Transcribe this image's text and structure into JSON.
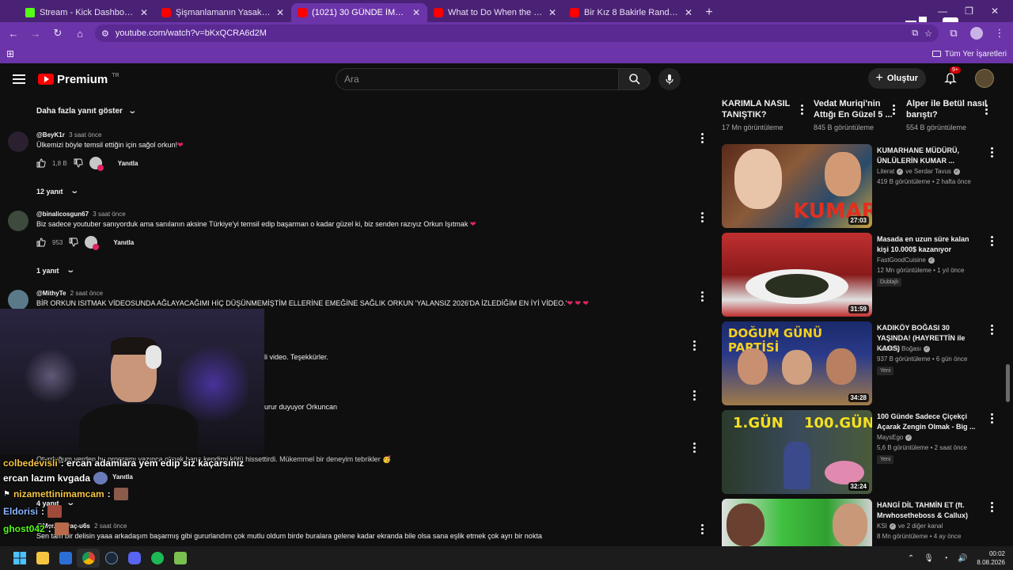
{
  "browser": {
    "tabs": [
      {
        "title": "Stream - Kick Dashboard",
        "favicon": "kick"
      },
      {
        "title": "Şişmanlamanın Yasak Olduğu Ü",
        "favicon": "youtube"
      },
      {
        "title": "(1021) 30 GÜNDE İMKANSIZI B",
        "favicon": "youtube",
        "active": true
      },
      {
        "title": "What to Do When the Gym Is B",
        "favicon": "youtube"
      },
      {
        "title": "Bir Kız 8 Bakirle Randevuda - Yo",
        "favicon": "youtube"
      }
    ],
    "url": "youtube.com/watch?v=bKxQCRA6d2M",
    "bookmarks_all": "Tüm Yer İşaretleri",
    "theme_color": "#6b34a8"
  },
  "yt_header": {
    "logo": "Premium",
    "region": "TR",
    "search_placeholder": "Ara",
    "create_label": "Oluştur",
    "notif_count": "9+"
  },
  "comments": {
    "more_replies": "Daha fazla yanıt göster",
    "reply_label": "Yanıtla",
    "items": [
      {
        "handle": "@BeyK1r",
        "time": "3 saat önce",
        "text": "Ülkemizi böyle temsil ettiğin için sağol orkun!",
        "likes": "1,8 B",
        "replies": "12 yanıt"
      },
      {
        "handle": "@binalicosgun67",
        "time": "3 saat önce",
        "text": "Biz sadece youtuber sanıyorduk ama sanılanın aksine Türkiye'yi temsil edip başarman o kadar güzel ki, biz senden razıyız Orkun Işıtmak",
        "likes": "953",
        "replies": "1 yanıt"
      },
      {
        "handle": "@MithyTe",
        "time": "2 saat önce",
        "text": "BİR ORKUN ISITMAK  VİDEOSUNDA  AĞLAYACAĞIMI HİÇ DÜŞÜNMEMİŞTİM ELLERİNE EMEĞİNE SAĞLIK ORKUN 'YALANSIZ 2026'DA  İZLEDİĞİM EN İYİ VİDEO.'"
      }
    ],
    "partial_1": "li video. Teşekkürler.",
    "partial_2": "urur duyuyor Orkuncan",
    "partial_3": "Oturduğum yerden bu programı yazınca olmak bana kendimi kötü hissettirdi. Mükemmel bir deneyim tebrikler",
    "partial_4_reply": "Yanıtla",
    "partial_4_replies": "4 yanıt",
    "last_handle": "@Mer... saraç-u6s",
    "last_time": "2 saat önce",
    "last_text": "Sen tam bir delisin yaaa arkadaşım başarmış gibi gururlandım çok mutlu oldum birde buralara gelene kadar ekranda bile olsa sana eşlik etmek çok ayrı bir nokta"
  },
  "chat": [
    {
      "user": "colbedevisli",
      "msg": ": ercan adamlara yem edip siz kaçarsınız",
      "color": "#f5c542"
    },
    {
      "user": "ercan lazım kvgada",
      "msg": "",
      "color": "#ffffff"
    },
    {
      "user": "nizamettinimamcam",
      "msg": ":",
      "color": "#f5c542"
    },
    {
      "user": "Eldorisi",
      "msg": ":",
      "color": "#8ab4ff"
    },
    {
      "user": "ghost042",
      "msg": ":",
      "color": "#53fc18"
    }
  ],
  "sidebar": {
    "top": [
      {
        "title": "KARIMLA NASIL TANIŞTIK?",
        "views": "17 Mn görüntüleme"
      },
      {
        "title": "Vedat Muriqi'nin Attığı En Güzel 5 ...",
        "views": "845 B görüntüleme"
      },
      {
        "title": "Alper ile Betül nasıl barıştı?",
        "views": "554 B görüntüleme"
      }
    ],
    "recs": [
      {
        "title": "KUMARHANE MÜDÜRÜ, ÜNLÜLERİN KUMAR ...",
        "channel": "Literat",
        "channel_extra": "ve Serdar Tavus",
        "meta": "419 B görüntüleme • 2 hafta önce",
        "duration": "27:03",
        "thumb_text": "KUMAR"
      },
      {
        "title": "Masada en uzun süre kalan kişi 10.000$ kazanıyor",
        "channel": "FastGoodCuisine",
        "channel_extra": "",
        "meta": "12 Mn görüntüleme • 1 yıl önce",
        "badge": "Dublajlı",
        "duration": "31:59"
      },
      {
        "title": "KADIKÖY BOĞASI 30 YAŞINDA! (HAYRETTİN ile KAOS)",
        "channel": "Kadıköy Boğası",
        "channel_extra": "",
        "meta": "937 B görüntüleme • 6 gün önce",
        "badge": "Yeni",
        "duration": "34:28",
        "thumb_text": "DOĞUM GÜNÜ PARTİSİ"
      },
      {
        "title": "100 Günde Sadece Çiçekçi Açarak Zengin Olmak - Big ...",
        "channel": "MaysEgo",
        "channel_extra": "",
        "meta": "5,6 B görüntüleme • 2 saat önce",
        "badge": "Yeni",
        "duration": "32:24",
        "thumb_text_a": "1.GÜN",
        "thumb_text_b": "100.GÜN"
      },
      {
        "title": "HANGİ DİL TAHMİN ET (ft. Mrwhosetheboss & Callux)",
        "channel": "KSI",
        "channel_extra": "ve 2 diğer kanal",
        "meta": "8 Mn görüntüleme • 4 ay önce"
      }
    ]
  },
  "taskbar": {
    "time": "00:02",
    "date": "8.08.2026"
  }
}
